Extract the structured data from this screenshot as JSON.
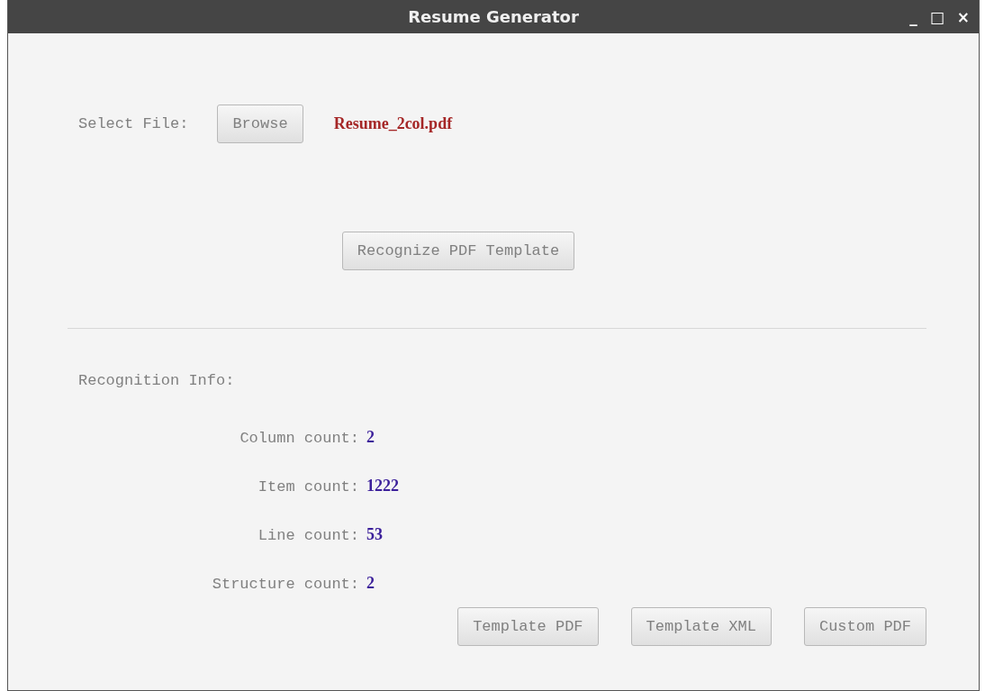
{
  "window": {
    "title": "Resume Generator",
    "controls": [
      "_",
      "□",
      "×"
    ]
  },
  "file": {
    "label": "Select File:",
    "browse": "Browse",
    "filename": "Resume_2col.pdf"
  },
  "recognize_button": "Recognize PDF Template",
  "info": {
    "heading": "Recognition Info:",
    "stats": [
      {
        "label": "Column count:",
        "value": "2"
      },
      {
        "label": "Item count:",
        "value": "1222"
      },
      {
        "label": "Line count:",
        "value": "53"
      },
      {
        "label": "Structure count:",
        "value": "2"
      }
    ]
  },
  "buttons": [
    "Template PDF",
    "Template XML",
    "Custom PDF"
  ]
}
